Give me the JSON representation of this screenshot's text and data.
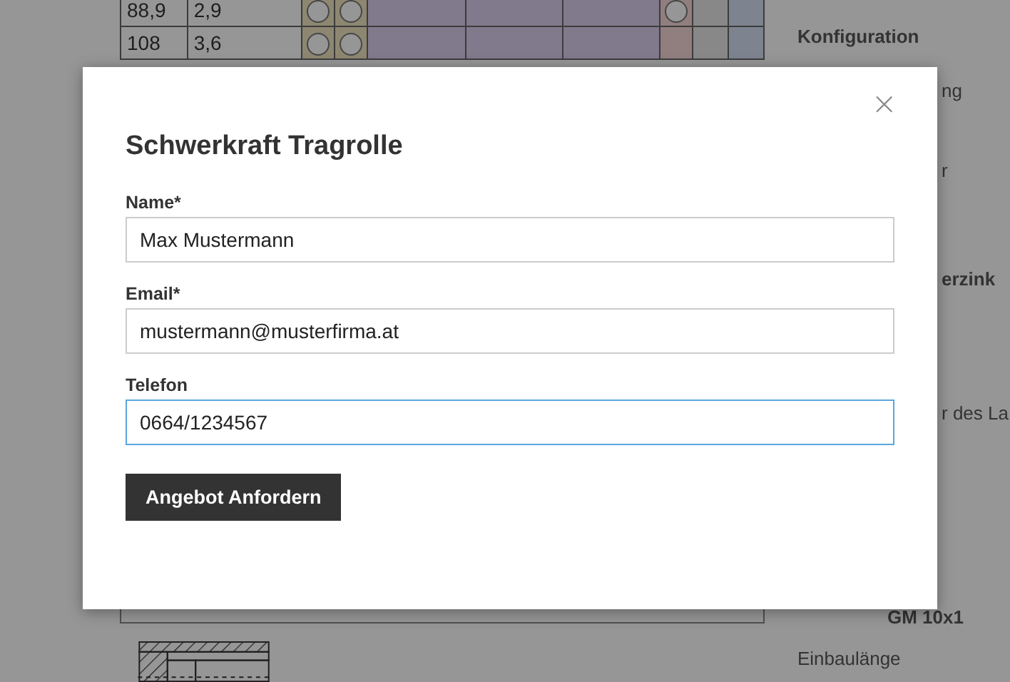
{
  "table": {
    "rows": [
      {
        "values": [
          "88,9",
          "2,9"
        ],
        "options": [
          true,
          true,
          false,
          false,
          false,
          true,
          false,
          false
        ]
      },
      {
        "values": [
          "108",
          "3,6"
        ],
        "options": [
          true,
          true,
          false,
          false,
          false,
          false,
          false,
          false
        ]
      }
    ]
  },
  "sidebar": {
    "items": [
      {
        "kind": "heading",
        "text": "Konfiguration"
      },
      {
        "kind": "text",
        "text": "ng"
      },
      {
        "kind": "text",
        "text": "r"
      },
      {
        "kind": "heading",
        "text": "erzink"
      },
      {
        "kind": "text",
        "text": "r des La"
      },
      {
        "kind": "heading",
        "text": "GM 10x1"
      },
      {
        "kind": "text",
        "text": "Einbaulänge"
      }
    ]
  },
  "dialog": {
    "title": "Schwerkraft Tragrolle",
    "close": "×",
    "fields": [
      {
        "label": "Name*",
        "value": "Max Mustermann",
        "focused": false
      },
      {
        "label": "Email*",
        "value": "mustermann@musterfirma.at",
        "focused": false
      },
      {
        "label": "Telefon",
        "value": "0664/1234567",
        "focused": true
      }
    ],
    "button": "Angebot Anfordern"
  }
}
